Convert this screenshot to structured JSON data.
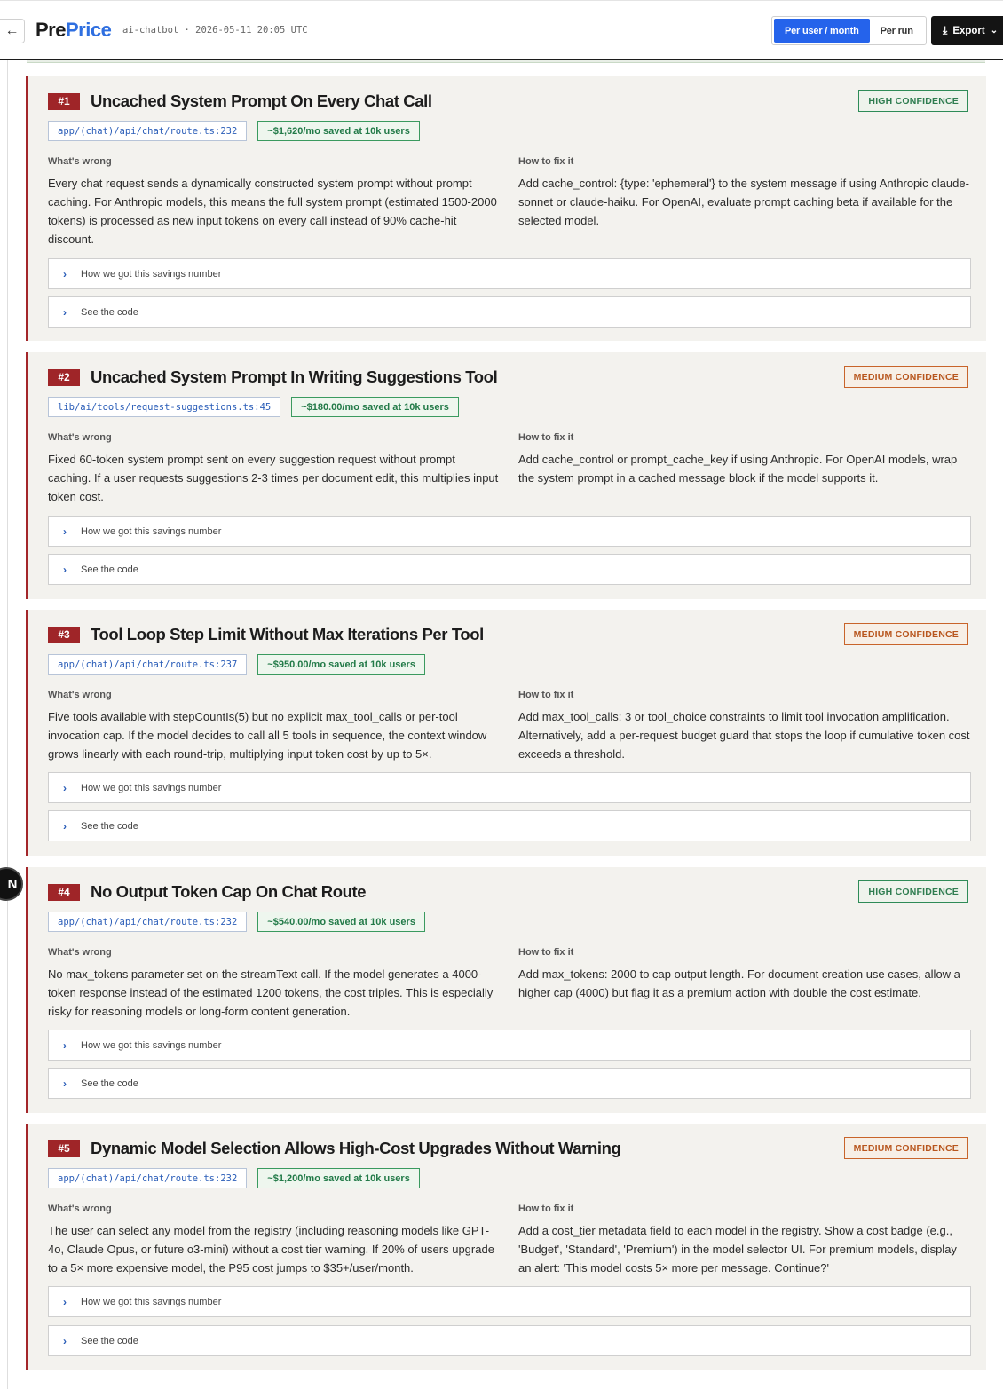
{
  "header": {
    "brand_part1": "Pre",
    "brand_part2": "Price",
    "meta": "ai-chatbot · 2026-05-11 20:05 UTC",
    "toggle_active": "Per user / month",
    "toggle_inactive": "Per run",
    "export_label": "Export"
  },
  "bubble_letter": "N",
  "colors": {
    "accent": "#2563eb",
    "danger": "#9f2528",
    "success": "#227a48",
    "warning": "#b8561e"
  },
  "findings": [
    {
      "num": "#1",
      "title": "Uncached System Prompt On Every Chat Call",
      "confidence": "HIGH CONFIDENCE",
      "confidence_level": "high",
      "file": "app/(chat)/api/chat/route.ts:232",
      "savings": "~$1,620/mo saved at 10k users",
      "wrong_label": "What's wrong",
      "wrong_text": "Every chat request sends a dynamically constructed system prompt without prompt caching. For Anthropic models, this means the full system prompt (estimated 1500-2000 tokens) is processed as new input tokens on every call instead of 90% cache-hit discount.",
      "fix_label": "How to fix it",
      "fix_text": "Add cache_control: {type: 'ephemeral'} to the system message if using Anthropic claude-sonnet or claude-haiku. For OpenAI, evaluate prompt caching beta if available for the selected model.",
      "savings_toggle": "How we got this savings number",
      "code_toggle": "See the code"
    },
    {
      "num": "#2",
      "title": "Uncached System Prompt In Writing Suggestions Tool",
      "confidence": "MEDIUM CONFIDENCE",
      "confidence_level": "medium",
      "file": "lib/ai/tools/request-suggestions.ts:45",
      "savings": "~$180.00/mo saved at 10k users",
      "wrong_label": "What's wrong",
      "wrong_text": "Fixed 60-token system prompt sent on every suggestion request without prompt caching. If a user requests suggestions 2-3 times per document edit, this multiplies input token cost.",
      "fix_label": "How to fix it",
      "fix_text": "Add cache_control or prompt_cache_key if using Anthropic. For OpenAI models, wrap the system prompt in a cached message block if the model supports it.",
      "savings_toggle": "How we got this savings number",
      "code_toggle": "See the code"
    },
    {
      "num": "#3",
      "title": "Tool Loop Step Limit Without Max Iterations Per Tool",
      "confidence": "MEDIUM CONFIDENCE",
      "confidence_level": "medium",
      "file": "app/(chat)/api/chat/route.ts:237",
      "savings": "~$950.00/mo saved at 10k users",
      "wrong_label": "What's wrong",
      "wrong_text": "Five tools available with stepCountIs(5) but no explicit max_tool_calls or per-tool invocation cap. If the model decides to call all 5 tools in sequence, the context window grows linearly with each round-trip, multiplying input token cost by up to 5×.",
      "fix_label": "How to fix it",
      "fix_text": "Add max_tool_calls: 3 or tool_choice constraints to limit tool invocation amplification. Alternatively, add a per-request budget guard that stops the loop if cumulative token cost exceeds a threshold.",
      "savings_toggle": "How we got this savings number",
      "code_toggle": "See the code"
    },
    {
      "num": "#4",
      "title": "No Output Token Cap On Chat Route",
      "confidence": "HIGH CONFIDENCE",
      "confidence_level": "high",
      "file": "app/(chat)/api/chat/route.ts:232",
      "savings": "~$540.00/mo saved at 10k users",
      "wrong_label": "What's wrong",
      "wrong_text": "No max_tokens parameter set on the streamText call. If the model generates a 4000-token response instead of the estimated 1200 tokens, the cost triples. This is especially risky for reasoning models or long-form content generation.",
      "fix_label": "How to fix it",
      "fix_text": "Add max_tokens: 2000 to cap output length. For document creation use cases, allow a higher cap (4000) but flag it as a premium action with double the cost estimate.",
      "savings_toggle": "How we got this savings number",
      "code_toggle": "See the code"
    },
    {
      "num": "#5",
      "title": "Dynamic Model Selection Allows High-Cost Upgrades Without Warning",
      "confidence": "MEDIUM CONFIDENCE",
      "confidence_level": "medium",
      "file": "app/(chat)/api/chat/route.ts:232",
      "savings": "~$1,200/mo saved at 10k users",
      "wrong_label": "What's wrong",
      "wrong_text": "The user can select any model from the registry (including reasoning models like GPT-4o, Claude Opus, or future o3-mini) without a cost tier warning. If 20% of users upgrade to a 5× more expensive model, the P95 cost jumps to $35+/user/month.",
      "fix_label": "How to fix it",
      "fix_text": "Add a cost_tier metadata field to each model in the registry. Show a cost badge (e.g., 'Budget', 'Standard', 'Premium') in the model selector UI. For premium models, display an alert: 'This model costs 5× more per message. Continue?'",
      "savings_toggle": "How we got this savings number",
      "code_toggle": "See the code"
    }
  ]
}
